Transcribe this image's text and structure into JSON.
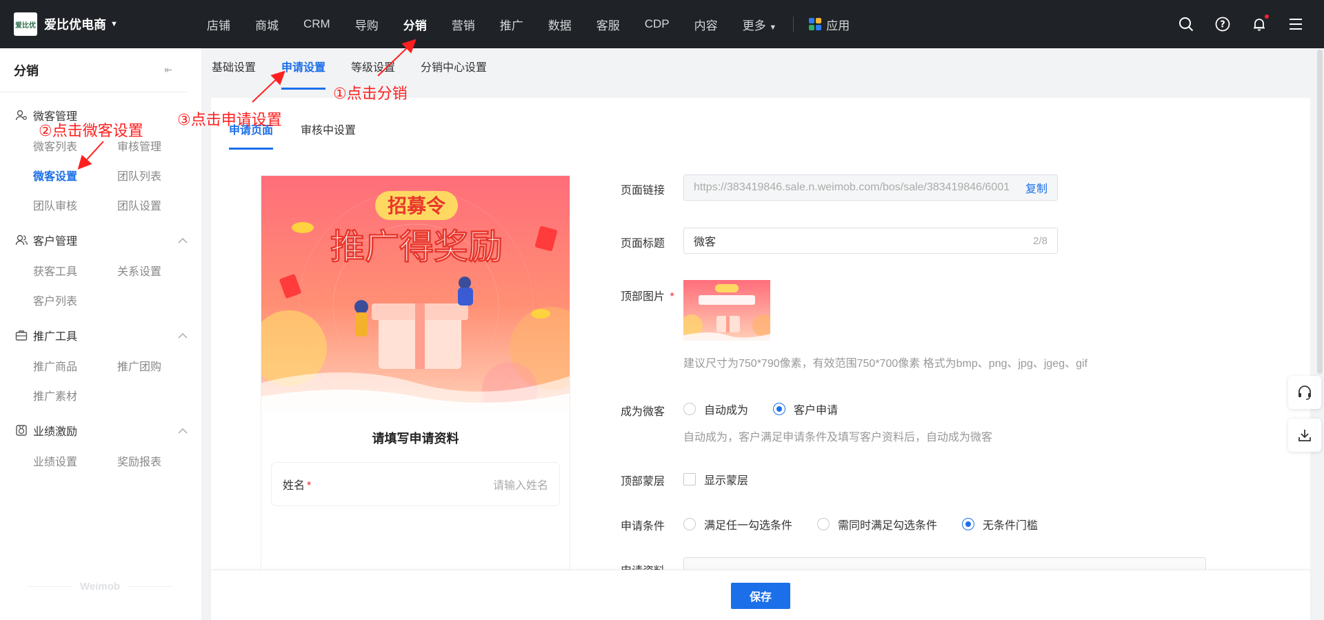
{
  "brand": {
    "logo_text": "爱比优",
    "name": "爱比优电商"
  },
  "topnav": {
    "items": [
      "店铺",
      "商城",
      "CRM",
      "导购",
      "分销",
      "营销",
      "推广",
      "数据",
      "客服",
      "CDP",
      "内容",
      "更多"
    ],
    "active": "分销",
    "apps_label": "应用"
  },
  "topicons": [
    "search-icon",
    "help-icon",
    "bell-icon",
    "menu-icon"
  ],
  "sidebar": {
    "title": "分销",
    "groups": [
      {
        "title": "微客管理",
        "items": [
          "微客列表",
          "审核管理",
          "微客设置",
          "团队列表",
          "团队审核",
          "团队设置"
        ]
      },
      {
        "title": "客户管理",
        "items": [
          "获客工具",
          "关系设置",
          "客户列表"
        ]
      },
      {
        "title": "推广工具",
        "items": [
          "推广商品",
          "推广团购",
          "推广素材"
        ]
      },
      {
        "title": "业绩激励",
        "items": [
          "业绩设置",
          "奖励报表"
        ]
      }
    ],
    "active_item": "微客设置",
    "footer": "Weimob"
  },
  "tabs_primary": [
    "基础设置",
    "申请设置",
    "等级设置",
    "分销中心设置"
  ],
  "tabs_primary_active": "申请设置",
  "tabs_secondary": [
    "申请页面",
    "审核中设置"
  ],
  "tabs_secondary_active": "申请页面",
  "preview": {
    "banner_badge": "招募令",
    "banner_title": "推广得奖励",
    "form_title": "请填写申请资料",
    "name_label": "姓名",
    "name_placeholder": "请输入姓名"
  },
  "form": {
    "page_link": {
      "label": "页面链接",
      "value": "https://383419846.sale.n.weimob.com/bos/sale/383419846/6001",
      "copy": "复制"
    },
    "page_title": {
      "label": "页面标题",
      "value": "微客",
      "count": "2/8"
    },
    "top_image": {
      "label": "顶部图片",
      "hint": "建议尺寸为750*790像素，有效范围750*700像素 格式为bmp、png、jpg、jgeg、gif"
    },
    "become": {
      "label": "成为微客",
      "options": [
        "自动成为",
        "客户申请"
      ],
      "selected": "客户申请",
      "hint": "自动成为，客户满足申请条件及填写客户资料后，自动成为微客"
    },
    "mask": {
      "label": "顶部蒙层",
      "option": "显示蒙层",
      "checked": false
    },
    "condition": {
      "label": "申请条件",
      "options": [
        "满足任一勾选条件",
        "需同时满足勾选条件",
        "无条件门槛"
      ],
      "selected": "无条件门槛"
    },
    "material": {
      "label": "申请资料"
    }
  },
  "save_label": "保存",
  "floaters": [
    "headset-icon",
    "download-icon"
  ],
  "annotations": [
    "①点击分销",
    "②点击微客设置",
    "③点击申请设置"
  ],
  "colors": {
    "accent": "#1b6fe8",
    "topbar": "#1f2226",
    "annotation": "#ff1f1f"
  }
}
